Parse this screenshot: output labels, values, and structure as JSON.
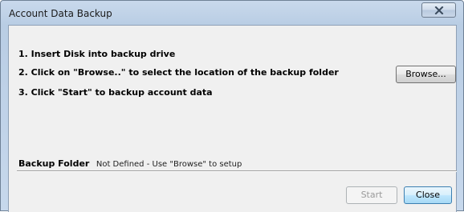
{
  "window": {
    "title": "Account Data Backup",
    "close_icon": "close-x-icon"
  },
  "instructions": {
    "step1": "1. Insert Disk into backup drive",
    "step2": "2. Click on \"Browse..\" to select the location of the backup folder",
    "step3": "3. Click \"Start\" to backup account data"
  },
  "buttons": {
    "browse": "Browse...",
    "start": "Start",
    "start_enabled": false,
    "close": "Close"
  },
  "backup_folder": {
    "label": "Backup Folder",
    "value": "Not Defined - Use \"Browse\" to setup"
  },
  "colors": {
    "title_bar": "#c3d4e8",
    "client_background": "#f0f0f0",
    "default_button_border": "#3c7fb1",
    "disabled_text": "#9a9a9a"
  }
}
